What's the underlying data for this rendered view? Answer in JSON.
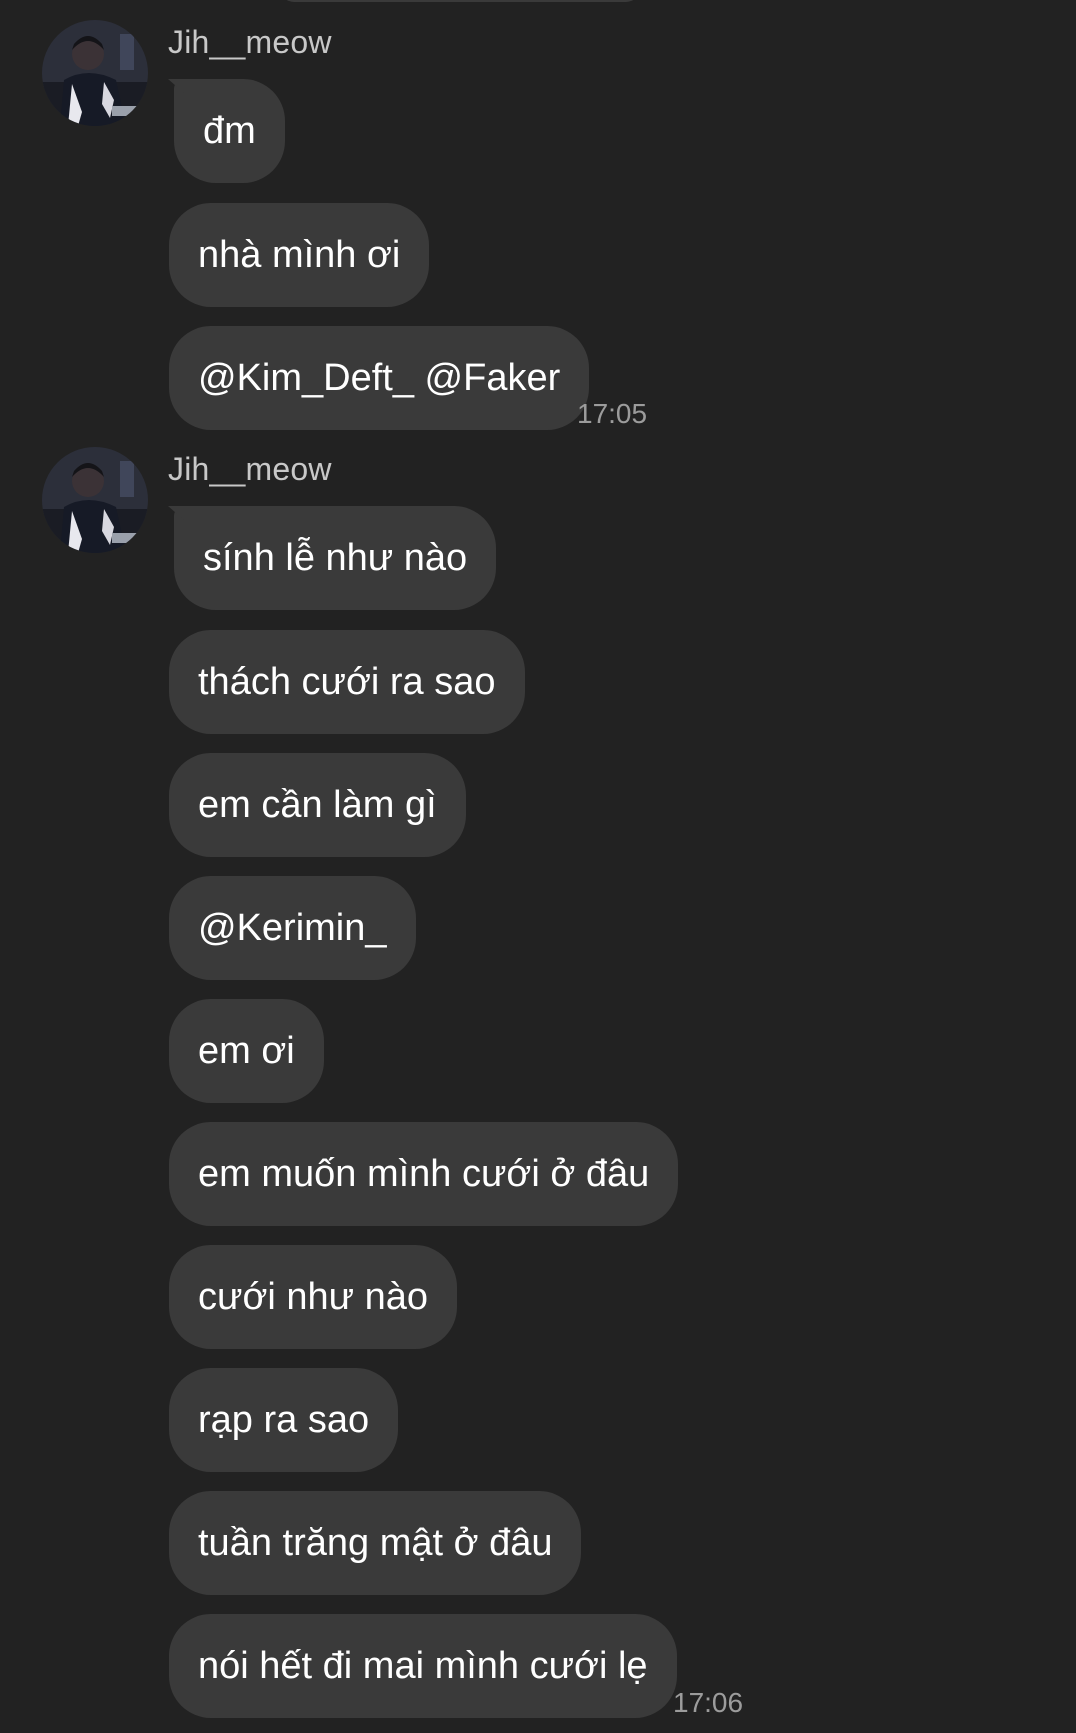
{
  "colors": {
    "background": "#222222",
    "bubble": "#3a3a3a",
    "sender_name": "#c8c8c8",
    "timestamp": "#9c9c9c",
    "text": "#ffffff"
  },
  "groups": [
    {
      "sender": "Jih__meow",
      "avatar_icon": "profile-photo-avatar",
      "messages": [
        "đm",
        "nhà mình ơi",
        "@Kim_Deft_ @Faker"
      ],
      "time": "17:05"
    },
    {
      "sender": "Jih__meow",
      "avatar_icon": "profile-photo-avatar",
      "messages": [
        "sính lễ như nào",
        "thách cưới ra sao",
        "em cần làm gì",
        "@Kerimin_",
        "em ơi",
        "em muốn mình cưới ở đâu",
        "cưới như nào",
        "rạp ra sao",
        "tuần trăng mật ở đâu",
        "nói hết đi mai mình cưới lẹ"
      ],
      "time": "17:06"
    }
  ]
}
